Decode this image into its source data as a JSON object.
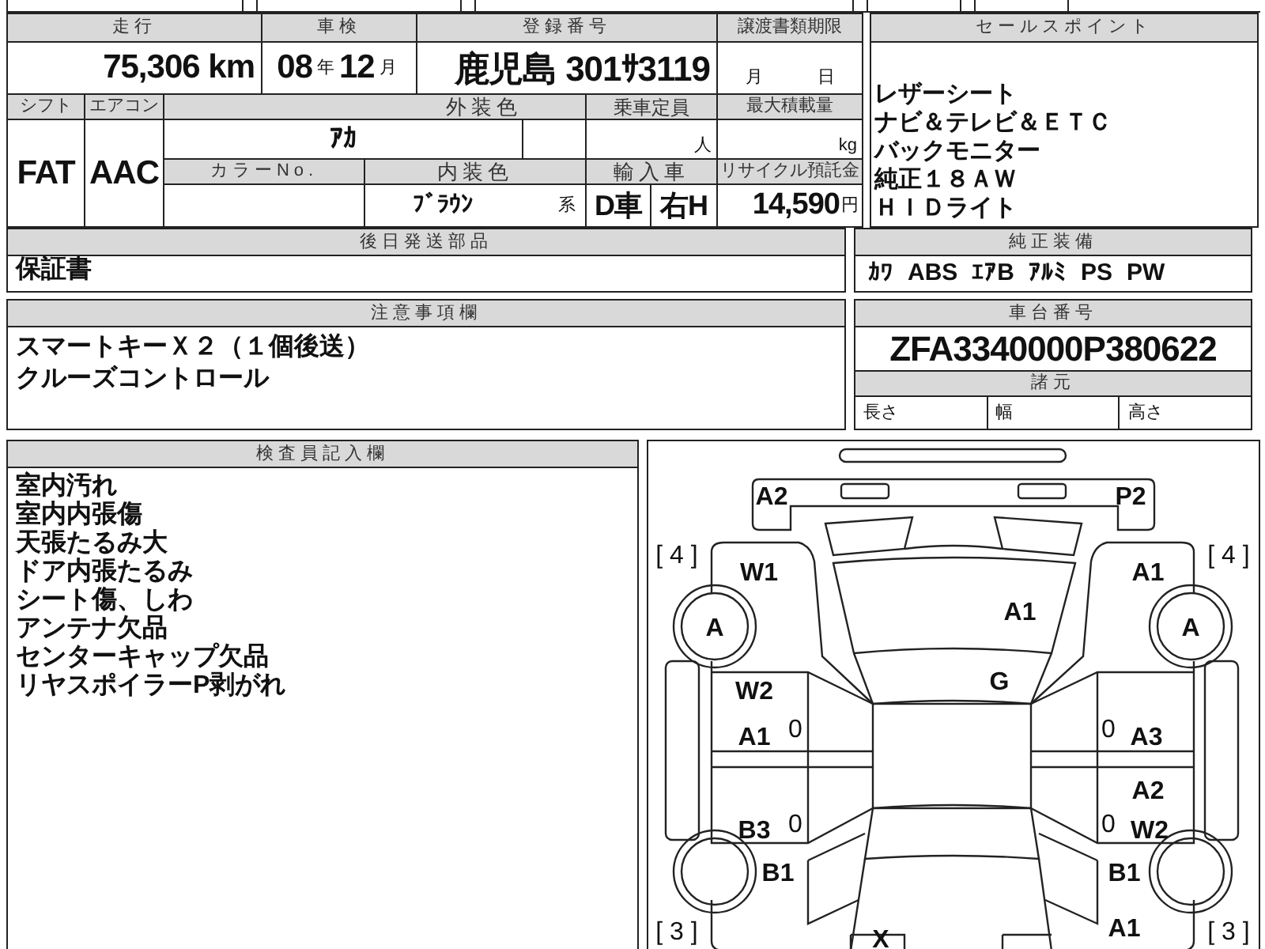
{
  "spec_table": {
    "mileage": {
      "label": "走行",
      "value": "75,306",
      "unit": "km"
    },
    "inspection": {
      "label": "車検",
      "year": "08",
      "year_unit": "年",
      "month": "12",
      "month_unit": "月"
    },
    "registration": {
      "label": "登録番号",
      "value": "鹿児島 301ｻ3119"
    },
    "transfer_deadline": {
      "label": "譲渡書類期限",
      "month_unit": "月",
      "day_unit": "日"
    },
    "shift": {
      "label": "シフト",
      "value": "FAT"
    },
    "aircon": {
      "label": "エアコン",
      "value": "AAC"
    },
    "exterior_color": {
      "label": "外装色",
      "value": "ｱｶ"
    },
    "capacity": {
      "label": "乗車定員",
      "unit": "人"
    },
    "max_load": {
      "label": "最大積載量",
      "unit": "kg"
    },
    "color_no": {
      "label": "カラーNo."
    },
    "interior_color": {
      "label": "内装色",
      "value": "ﾌﾞﾗｳﾝ",
      "suffix": "系"
    },
    "import": {
      "label": "輸入車",
      "dealer": "D車",
      "steering": "右H"
    },
    "recycle_fee": {
      "label": "リサイクル預託金",
      "value": "14,590",
      "unit": "円"
    }
  },
  "sales_points": {
    "label": "セールスポイント",
    "lines": [
      "レザーシート",
      "ナビ＆テレビ＆ＥＴＣ",
      "バックモニター",
      "純正１８ＡＷ",
      "ＨＩＤライト"
    ]
  },
  "later_parts": {
    "label": "後日発送部品",
    "lines": [
      "保証書"
    ]
  },
  "equipment": {
    "label": "純正装備",
    "items": [
      "ｶﾜ",
      "ABS",
      "ｴｱB",
      "ｱﾙﾐ",
      "PS",
      "PW"
    ]
  },
  "notes": {
    "label": "注意事項欄",
    "lines": [
      "スマートキーＸ２（１個後送）",
      "クルーズコントロール"
    ]
  },
  "chassis": {
    "label": "車台番号",
    "value": "ZFA3340000P380622"
  },
  "dimensions": {
    "label": "諸元",
    "fields": [
      "長さ",
      "幅",
      "高さ"
    ]
  },
  "inspector_notes": {
    "label": "検査員記入欄",
    "lines": [
      "室内汚れ",
      "室内内張傷",
      "天張たるみ大",
      "ドア内張たるみ",
      "シート傷、しわ",
      "アンテナ欠品",
      "センターキャップ欠品",
      "リヤスポイラーP剥がれ"
    ]
  },
  "damage_map": {
    "front_bumper_left": "A2",
    "front_bumper_right": "P2",
    "tread_front_left": "[ 4 ]",
    "front_left_fender": "W1",
    "front_right_fender": "A1",
    "tread_front_right": "[ 4 ]",
    "hood": "A1",
    "front_left_wheel": "A",
    "front_right_wheel": "A",
    "windshield": "G",
    "front_left_door_upper": "W2",
    "front_left_door_lower": "A1",
    "front_left_handle": "0",
    "front_right_handle": "0",
    "front_right_door": "A3",
    "rear_right_door_upper": "A2",
    "rear_left_door": "B3",
    "rear_left_handle": "0",
    "rear_right_handle": "0",
    "rear_right_door_lower": "W2",
    "rear_left_fender": "B1",
    "rear_right_fender": "B1",
    "rear_right_quarter": "A1",
    "tread_rear_left": "[ 3 ]",
    "rear_plate": "X",
    "tread_rear_right": "[ 3 ]"
  }
}
